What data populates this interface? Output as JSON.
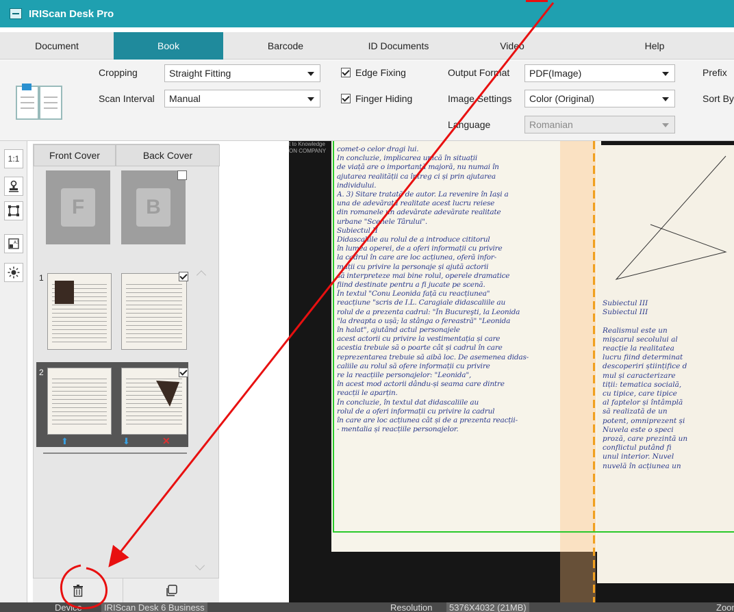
{
  "window": {
    "title": "IRIScan Desk Pro"
  },
  "tabs": [
    {
      "label": "Document"
    },
    {
      "label": "Book"
    },
    {
      "label": "Barcode"
    },
    {
      "label": "ID Documents"
    },
    {
      "label": "Video"
    },
    {
      "label": "Help"
    }
  ],
  "ribbon": {
    "cropping_label": "Cropping",
    "cropping_value": "Straight Fitting",
    "scan_interval_label": "Scan Interval",
    "scan_interval_value": "Manual",
    "edge_fixing_label": "Edge Fixing",
    "finger_hiding_label": "Finger Hiding",
    "output_format_label": "Output Format",
    "output_format_value": "PDF(Image)",
    "image_settings_label": "Image Settings",
    "image_settings_value": "Color (Original)",
    "language_label": "Language",
    "language_value": "Romanian",
    "prefix_label": "Prefix",
    "sort_by_label": "Sort By"
  },
  "left_tools": [
    {
      "name": "actual-size",
      "label": "1:1"
    },
    {
      "name": "stamp-icon",
      "label": ""
    },
    {
      "name": "crop-icon",
      "label": ""
    },
    {
      "name": "a3-icon",
      "label": ""
    },
    {
      "name": "brightness-icon",
      "label": ""
    }
  ],
  "thumbs": {
    "front_cover": "Front Cover",
    "back_cover": "Back Cover",
    "front_letter": "F",
    "back_letter": "B",
    "pages": [
      {
        "number": "1",
        "checked": true
      },
      {
        "number": "2",
        "checked": true
      }
    ]
  },
  "viewer": {
    "edge_text_1": "t to Knowledge",
    "edge_text_2": "ON COMPANY",
    "left_page_lines": [
      "comet-o celor dragi lui.",
      "In concluzie, implicarea unică în situații",
      "de viață are o importanță majoră, nu numai în",
      "ajutarea realității ca întreg ci și prin ajutarea",
      "individului.",
      "A. 3) Sitare tratată de autor. La revenire în Iași a",
      "una de adevărată realitate acest lucru reiese",
      "din romanele un adevărate adevărate realitate",
      "urbane \"Scenele Târului\".",
      "Subiectul II",
      "Didascaliile au rolul de a introduce cititorul",
      "în lumea operei, de a oferi informații cu privire",
      "la cadrul în care are loc acțiunea, oferă infor-",
      "mații cu privire la personaje și ajută actorii",
      "să interpreteze mai bine rolul, operele dramatice",
      "fiind destinate pentru a fi jucate pe scenă.",
      "În textul \"Conu Leonida față cu reacțiunea\"",
      "reacțiune \"scris de I.L. Caragiale didascaliile au",
      "rolul de a prezenta cadrul: \"În Bucureşti, la Leonida",
      "\"la dreapta o ușă; la stânga o fereastră\" \"Leonida",
      "în halat\", ajutând actul personajele",
      "acest actorii cu privire la vestimentația și care",
      "acestia trebuie să o poarte cât și cadrul în care",
      "reprezentarea trebuie să aibă loc. De asemenea didas-",
      "caliile au rolul să ofere informații cu privire",
      "re la reacțiile personajelor: \"Leonida\",",
      "în acest mod actorii dându-și seama care dintre",
      "reacții le aparțin.",
      "În concluzie, în textul dat didascaliile au",
      "rolul de a oferi informații cu privire la cadrul",
      "în care are loc acțiunea cât și de a prezenta reacții-",
      "- mentalia și reacțiile personajelor."
    ],
    "right_page_lines": [
      "Subiectul III",
      "Subiectul III",
      "",
      "Realismul este un",
      "mișcarul secolului al",
      "reacție la realitatea",
      "lucru fiind determinat",
      "descoperiri științifice d",
      "mul și caracterizare",
      "tiții: tematica socială,",
      "cu tipice, care tipice",
      "al faptelor și întâmplă",
      "să realizată de un",
      "potent, omniprezent și",
      "Nuvela este o speci",
      "proză, care prezintă un",
      "conflictul putând fi",
      "unul interior. Nuvel",
      "nuvelă în acțiunea un"
    ]
  },
  "status": {
    "device_label": "Device",
    "device_value": "IRIScan Desk 6 Business",
    "resolution_label": "Resolution",
    "resolution_value": "5376X4032 (21MB)",
    "zoom_label": "Zoom"
  },
  "annotation_color": "#e81010"
}
